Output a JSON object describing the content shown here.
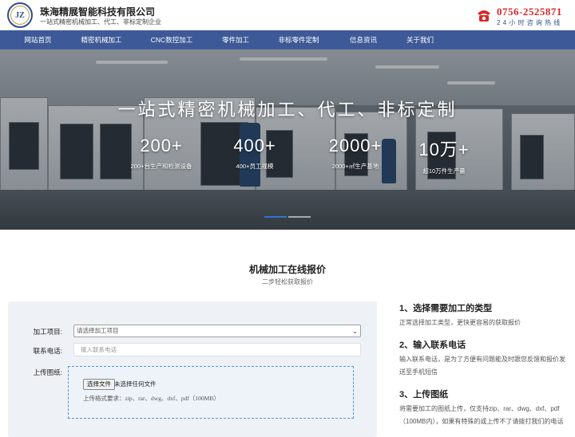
{
  "header": {
    "logo_text": "JZ",
    "company_name": "珠海精展智能科技有限公司",
    "tagline": "一站式精密机械加工、代工、非标定制企业",
    "phone": "0756-2525871",
    "phone_sub": "24小时咨询热线"
  },
  "nav": {
    "items": [
      {
        "label": "网站首页"
      },
      {
        "label": "精密机械加工"
      },
      {
        "label": "CNC数控加工"
      },
      {
        "label": "零件加工"
      },
      {
        "label": "非标零件定制"
      },
      {
        "label": "信息资讯"
      },
      {
        "label": "关于我们"
      }
    ]
  },
  "banner": {
    "wall_text": "质",
    "headline": "一站式精密机械加工、代工、非标定制",
    "stats": [
      {
        "value": "200+",
        "label": "200+台生产和检测设备"
      },
      {
        "value": "400+",
        "label": "400+员工规模"
      },
      {
        "value": "2000+",
        "label": "2000+㎡生产基地"
      },
      {
        "value": "10万+",
        "label": "超10万件生产量"
      }
    ]
  },
  "quote": {
    "title": "机械加工在线报价",
    "subtitle": "二步轻松获取报价",
    "form": {
      "type_label": "加工项目:",
      "type_placeholder": "请选择加工项目",
      "phone_label": "联系电话:",
      "phone_placeholder": "输入联系电话",
      "upload_label": "上传图纸:",
      "file_button": "选择文件",
      "file_none": "未选择任何文件",
      "file_hint": "上传格式要求：zip、rar、dwg、dxf、pdf（100MB）"
    },
    "steps": [
      {
        "title": "1、选择需要加工的类型",
        "desc": "正常选择加工类型，更快更容易的获取报价"
      },
      {
        "title": "2、输入联系电话",
        "desc": "输入联系电话，是为了方便有问题能及时跟您反馈和报价发送至手机短信"
      },
      {
        "title": "3、上传图纸",
        "desc": "将需要加工的图纸上传，仅支持zip、rar、dwg、dxf、pdf（100MB内），如果有特殊的或上传不了请拨打我们的电话"
      }
    ]
  },
  "colors": {
    "nav_bg": "#3e5997",
    "phone_red": "#d6282a",
    "accent_blue": "#2f74c9"
  }
}
